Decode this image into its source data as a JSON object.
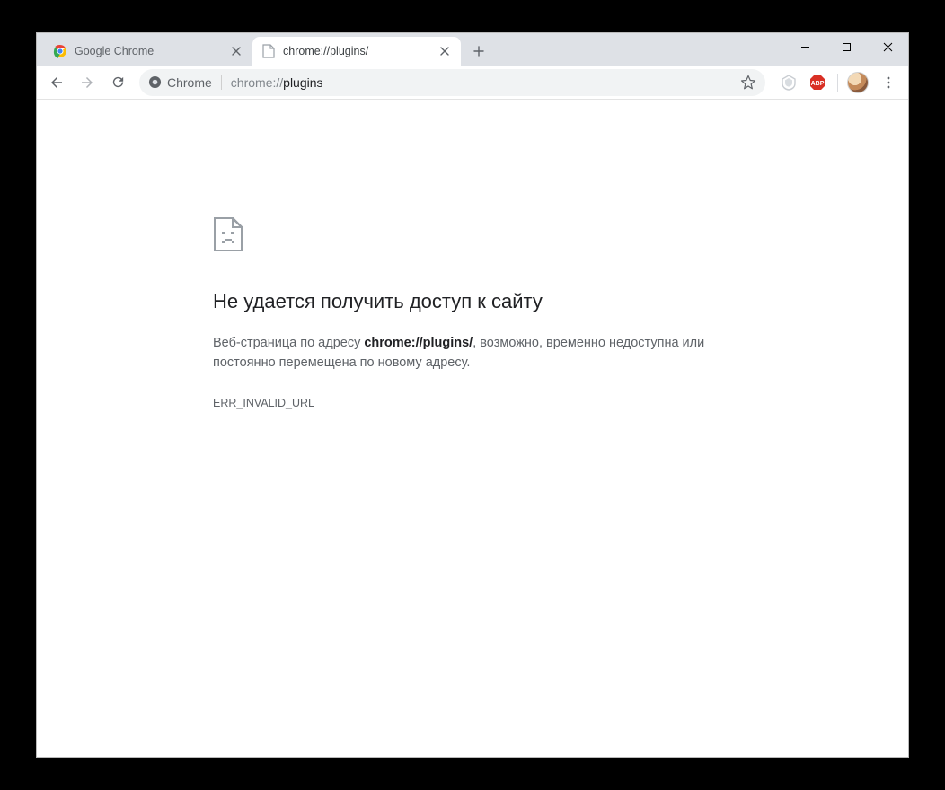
{
  "tabs": [
    {
      "label": "Google Chrome",
      "active": false
    },
    {
      "label": "chrome://plugins/",
      "active": true
    }
  ],
  "omnibox": {
    "chip_label": "Chrome",
    "url_prefix": "chrome://",
    "url_strong": "plugins"
  },
  "error": {
    "title": "Не удается получить доступ к сайту",
    "desc_before": "Веб-страница по адресу ",
    "desc_bold": "chrome://plugins/",
    "desc_after": ", возможно, временно недоступна или постоянно перемещена по новому адресу.",
    "code": "ERR_INVALID_URL"
  }
}
